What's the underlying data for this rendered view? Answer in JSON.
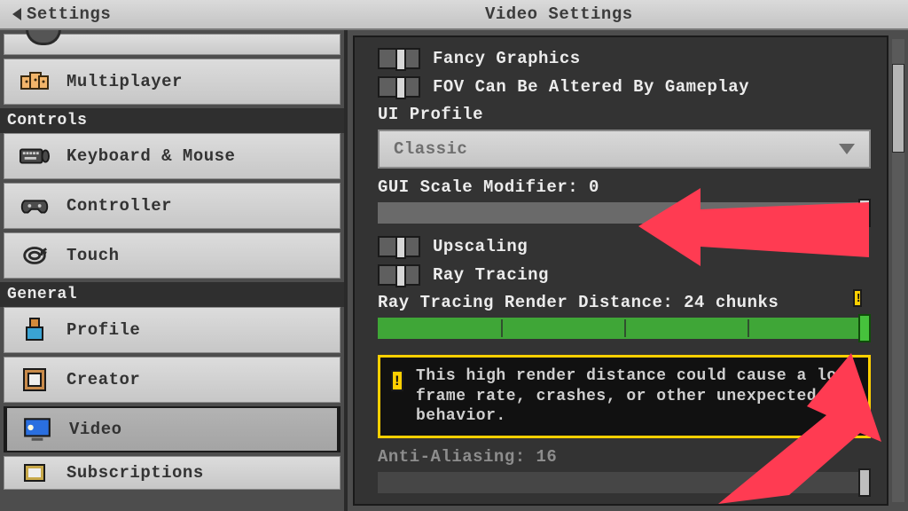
{
  "header": {
    "back_label": "Settings",
    "title": "Video Settings"
  },
  "sidebar": {
    "sections": [
      {
        "header": null,
        "items": [
          {
            "label": "Multiplayer",
            "icon": "multiplayer"
          }
        ]
      },
      {
        "header": "Controls",
        "items": [
          {
            "label": "Keyboard & Mouse",
            "icon": "keyboard"
          },
          {
            "label": "Controller",
            "icon": "controller"
          },
          {
            "label": "Touch",
            "icon": "touch"
          }
        ]
      },
      {
        "header": "General",
        "items": [
          {
            "label": "Profile",
            "icon": "profile"
          },
          {
            "label": "Creator",
            "icon": "creator"
          },
          {
            "label": "Video",
            "icon": "video",
            "selected": true
          },
          {
            "label": "Subscriptions",
            "icon": "subs"
          }
        ]
      }
    ]
  },
  "settings": {
    "fancy_graphics": {
      "label": "Fancy Graphics",
      "value": false
    },
    "fov_alter": {
      "label": "FOV Can Be Altered By Gameplay",
      "value": false
    },
    "ui_profile": {
      "label": "UI Profile",
      "selected": "Classic"
    },
    "gui_scale": {
      "label": "GUI Scale Modifier: 0",
      "value": 0,
      "max": 1
    },
    "upscaling": {
      "label": "Upscaling",
      "value": false
    },
    "ray_tracing": {
      "label": "Ray Tracing",
      "value": false
    },
    "rt_distance": {
      "label": "Ray Tracing Render Distance: 24 chunks",
      "value": 24,
      "max": 24
    },
    "warning": "This high render distance could cause a low frame rate, crashes, or other unexpected behavior.",
    "anti_aliasing": {
      "label": "Anti-Aliasing: 16",
      "value": 16,
      "max": 16
    }
  }
}
